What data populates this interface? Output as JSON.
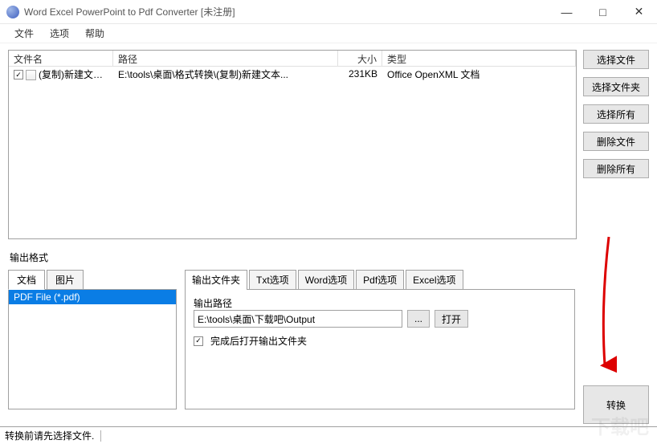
{
  "titlebar": {
    "title": "Word Excel PowerPoint to Pdf Converter [未注册]"
  },
  "menu": {
    "file": "文件",
    "options": "选项",
    "help": "帮助"
  },
  "filelist": {
    "headers": {
      "name": "文件名",
      "path": "路径",
      "size": "大小",
      "type": "类型"
    },
    "rows": [
      {
        "name": "(复制)新建文本...",
        "path": "E:\\tools\\桌面\\格式转换\\(复制)新建文本...",
        "size": "231KB",
        "type": "Office OpenXML 文档"
      }
    ]
  },
  "sidebuttons": {
    "select_file": "选择文件",
    "select_folder": "选择文件夹",
    "select_all": "选择所有",
    "delete_file": "删除文件",
    "delete_all": "删除所有"
  },
  "outputformat": {
    "label": "输出格式",
    "tab_doc": "文档",
    "tab_img": "图片",
    "item_pdf": "PDF File  (*.pdf)"
  },
  "outpanel": {
    "tab_folder": "输出文件夹",
    "tab_txt": "Txt选项",
    "tab_word": "Word选项",
    "tab_pdf": "Pdf选项",
    "tab_excel": "Excel选项",
    "path_label": "输出路径",
    "path_value": "E:\\tools\\桌面\\下载吧\\Output",
    "browse": "...",
    "open": "打开",
    "open_after": "完成后打开输出文件夹"
  },
  "convert": "转换",
  "status": "转换前请先选择文件.",
  "watermark": "下载吧"
}
